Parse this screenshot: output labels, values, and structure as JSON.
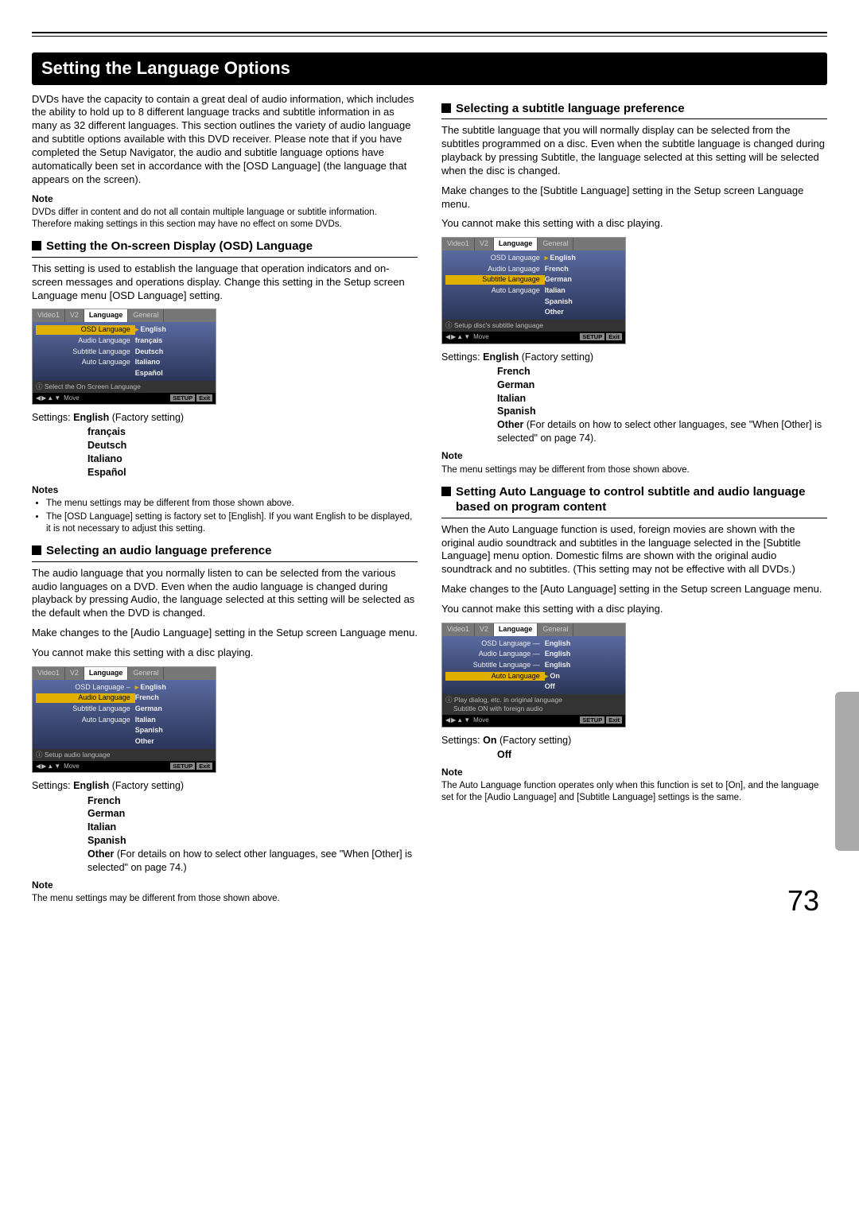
{
  "page_number": "73",
  "section_title": "Setting the Language Options",
  "intro": "DVDs have the capacity to contain a great deal of audio information, which includes the ability to hold up to 8 different language tracks and subtitle information in as many as 32 different languages. This section outlines the variety of audio language and subtitle options available with this DVD receiver. Please note that if you have completed the Setup Navigator, the audio and subtitle language options have automatically been set in accordance with the [OSD Language] (the language that appears on the screen).",
  "note_hd": "Note",
  "notes_hd": "Notes",
  "intro_note": "DVDs differ in content and do not all contain multiple language or subtitle information. Therefore making settings in this section may have no effect on some DVDs.",
  "osd_section": {
    "heading": "Setting the On-screen Display (OSD) Language",
    "body": "This setting is used to establish the language that operation indicators and on-screen messages and operations display. Change this setting in the Setup screen Language menu [OSD Language] setting.",
    "settings_label": "Settings:",
    "factory": "English",
    "factory_suffix": "(Factory setting)",
    "opts": [
      "français",
      "Deutsch",
      "Italiano",
      "Español"
    ],
    "notes": [
      "The menu settings may be different from those shown above.",
      "The [OSD Language] setting is factory set to [English]. If you want English to be displayed, it is not necessary to adjust this setting."
    ],
    "menu": {
      "tabs": [
        "Video1",
        "V2",
        "Language",
        "General"
      ],
      "rows": [
        {
          "l": "OSD Language",
          "r": "English",
          "hl": true,
          "p": true
        },
        {
          "l": "Audio Language",
          "r": "français"
        },
        {
          "l": "Subtitle Language",
          "r": "Deutsch"
        },
        {
          "l": "Auto Language",
          "r": "Italiano"
        },
        {
          "l": "",
          "r": "Español"
        }
      ],
      "tip": "Select the On Screen Language",
      "move": "Move",
      "setup": "SETUP",
      "exit": "Exit"
    }
  },
  "audio_section": {
    "heading": "Selecting an audio language preference",
    "body": "The audio language that you normally listen to can be selected from the various audio languages on a DVD. Even when the audio language is changed during playback by pressing Audio, the language selected at this setting will be selected as the default when the DVD is changed.",
    "body2": "Make changes to the [Audio Language] setting in the Setup screen Language menu.",
    "body3": "You cannot make this setting with a disc playing.",
    "settings_label": "Settings:",
    "factory": "English",
    "factory_suffix": "(Factory setting)",
    "opts": [
      "French",
      "German",
      "Italian",
      "Spanish"
    ],
    "other_label": "Other",
    "other_text": "(For details on how to select other languages, see \"When [Other] is selected\" on  page 74.)",
    "note": "The menu settings may be different from those shown above.",
    "menu": {
      "tabs": [
        "Video1",
        "V2",
        "Language",
        "General"
      ],
      "rows": [
        {
          "l": "OSD Language –",
          "r": "English",
          "p": true
        },
        {
          "l": "Audio Language",
          "r": "French",
          "hl": true
        },
        {
          "l": "Subtitle Language",
          "r": "German"
        },
        {
          "l": "Auto Language",
          "r": "Italian"
        },
        {
          "l": "",
          "r": "Spanish"
        },
        {
          "l": "",
          "r": "Other"
        }
      ],
      "tip": "Setup audio language",
      "move": "Move",
      "setup": "SETUP",
      "exit": "Exit"
    }
  },
  "subtitle_section": {
    "heading": "Selecting a subtitle language preference",
    "body": "The subtitle language that you will normally display can be selected from the subtitles programmed on a disc. Even when the subtitle language is changed during playback by pressing Subtitle, the language selected at this setting will be selected when the disc is changed.",
    "body2": "Make changes to the [Subtitle Language] setting in the Setup screen Language menu.",
    "body3": "You cannot make this setting with a disc playing.",
    "settings_label": "Settings:",
    "factory": "English",
    "factory_suffix": "(Factory setting)",
    "opts": [
      "French",
      "German",
      "Italian",
      "Spanish"
    ],
    "other_label": "Other",
    "other_text": "(For details on how to select other languages, see \"When [Other] is selected\" on page 74).",
    "note": "The menu settings may be different from those shown above.",
    "menu": {
      "tabs": [
        "Video1",
        "V2",
        "Language",
        "General"
      ],
      "rows": [
        {
          "l": "OSD Language",
          "r": "English",
          "p": true
        },
        {
          "l": "Audio Language",
          "r": "French"
        },
        {
          "l": "Subtitle Language",
          "r": "German",
          "hl": true
        },
        {
          "l": "Auto Language",
          "r": "Italian"
        },
        {
          "l": "",
          "r": "Spanish"
        },
        {
          "l": "",
          "r": "Other"
        }
      ],
      "tip": "Setup disc's subtitle language",
      "move": "Move",
      "setup": "SETUP",
      "exit": "Exit"
    }
  },
  "auto_section": {
    "heading": "Setting Auto Language to control subtitle and audio language based on program content",
    "body": "When the Auto Language function is used, foreign movies are shown with the original audio soundtrack and subtitles in the language selected in the [Subtitle Language] menu option. Domestic films are shown with the original audio soundtrack and no subtitles. (This setting may not be effective with all DVDs.)",
    "body2": "Make changes to the [Auto Language] setting in the Setup screen Language menu.",
    "body3": "You cannot make this setting with a disc playing.",
    "settings_label": "Settings:",
    "factory": "On",
    "factory_suffix": "(Factory setting)",
    "opts": [
      "Off"
    ],
    "note": "The Auto Language function operates only when this function is set to [On], and the language set for the [Audio Language] and [Subtitle Language] settings is the same.",
    "menu": {
      "tabs": [
        "Video1",
        "V2",
        "Language",
        "General"
      ],
      "rows": [
        {
          "l": "OSD Language —",
          "r": "English"
        },
        {
          "l": "Audio Language —",
          "r": "English"
        },
        {
          "l": "Subtitle Language —",
          "r": "English"
        },
        {
          "l": "Auto Language",
          "r": "On",
          "hl": true,
          "p": true
        },
        {
          "l": "",
          "r": "Off"
        }
      ],
      "tip": "Play dialog, etc. in original language",
      "tip2": "Subtitle ON with foreign audio",
      "move": "Move",
      "setup": "SETUP",
      "exit": "Exit"
    }
  }
}
